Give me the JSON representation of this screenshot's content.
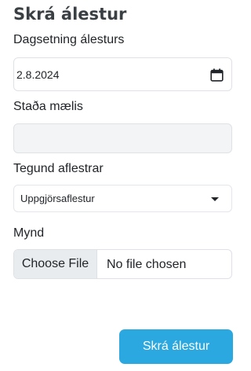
{
  "form": {
    "title": "Skrá álestur",
    "date_field": {
      "label": "Dagsetning álesturs",
      "value": "2.8.2024",
      "icon": "calendar-icon"
    },
    "meter_status_field": {
      "label": "Staða mælis",
      "value": ""
    },
    "reading_type_field": {
      "label": "Tegund aflestrar",
      "selected": "Uppgjörsaflestur"
    },
    "image_field": {
      "label": "Mynd",
      "button_label": "Choose File",
      "status_text": "No file chosen"
    },
    "submit_label": "Skrá álestur"
  },
  "colors": {
    "accent": "#2aa8df",
    "title": "#3a3f44",
    "input_border": "#dee2e6",
    "disabled_bg": "#f3f4f5",
    "file_button_bg": "#e9ecef"
  }
}
